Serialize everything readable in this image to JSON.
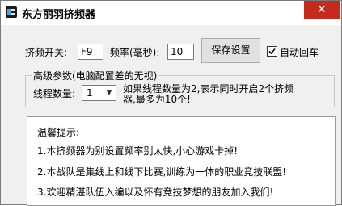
{
  "window": {
    "title": "东方丽羽挤频器",
    "close_symbol": "✕"
  },
  "controls": {
    "toggle_label": "挤频开关:",
    "toggle_key_value": "F9",
    "freq_label": "频率(毫秒):",
    "freq_value": "10",
    "save_button": "保存设置",
    "auto_return_label": "自动回车",
    "auto_return_checked": true
  },
  "advanced": {
    "legend": "高级参数(电脑配置差的无视)",
    "thread_label": "线程数量:",
    "thread_value": "1",
    "note_line1": "如果线程数量为2,表示同时开启2个挤频",
    "note_line2": "器,最多为10个!"
  },
  "tips": {
    "title": "温馨提示:",
    "items": [
      "1.本挤频器为别设置频率别太快,小心游戏卡掉!",
      "2.本战队是集线上和线下比赛,训练为一体的职业竞技联盟!",
      "3.欢迎精湛队伍入编以及怀有竞技梦想的朋友加入我们!"
    ]
  },
  "colors": {
    "close_button": "#c42b1c",
    "window_bg": "#f0f0f0"
  }
}
